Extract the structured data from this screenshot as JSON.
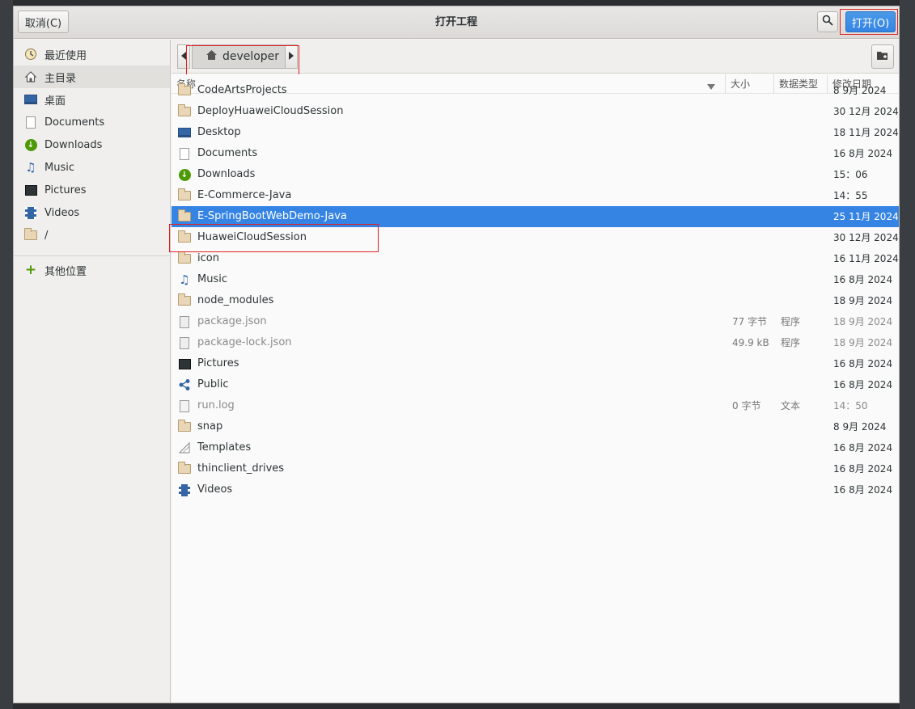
{
  "dialog": {
    "title": "打开工程",
    "cancel_label": "取消(C)",
    "open_label": "打开(O)"
  },
  "sidebar": {
    "items": [
      {
        "label": "最近使用",
        "icon": "recent-icon"
      },
      {
        "label": "主目录",
        "icon": "home-icon"
      },
      {
        "label": "桌面",
        "icon": "desktop-icon"
      },
      {
        "label": "Documents",
        "icon": "document-icon"
      },
      {
        "label": "Downloads",
        "icon": "download-icon"
      },
      {
        "label": "Music",
        "icon": "music-icon"
      },
      {
        "label": "Pictures",
        "icon": "pictures-icon"
      },
      {
        "label": "Videos",
        "icon": "videos-icon"
      },
      {
        "label": "/",
        "icon": "folder-icon"
      }
    ],
    "other_locations": "其他位置"
  },
  "pathbar": {
    "current": "developer"
  },
  "columns": {
    "name": "名称",
    "size": "大小",
    "type": "数据类型",
    "modified": "修改日期"
  },
  "files": [
    {
      "name": "CodeArtsProjects",
      "size": "",
      "type": "",
      "modified": "8 9月 2024",
      "icon": "folder"
    },
    {
      "name": "DeployHuaweiCloudSession",
      "size": "",
      "type": "",
      "modified": "30 12月 2024",
      "icon": "folder"
    },
    {
      "name": "Desktop",
      "size": "",
      "type": "",
      "modified": "18 11月 2024",
      "icon": "desktop"
    },
    {
      "name": "Documents",
      "size": "",
      "type": "",
      "modified": "16 8月 2024",
      "icon": "document"
    },
    {
      "name": "Downloads",
      "size": "",
      "type": "",
      "modified": "15：06",
      "icon": "download"
    },
    {
      "name": "E-Commerce-Java",
      "size": "",
      "type": "",
      "modified": "14：55",
      "icon": "folder"
    },
    {
      "name": "E-SpringBootWebDemo-Java",
      "size": "",
      "type": "",
      "modified": "25 11月 2024",
      "icon": "folder"
    },
    {
      "name": "HuaweiCloudSession",
      "size": "",
      "type": "",
      "modified": "30 12月 2024",
      "icon": "folder"
    },
    {
      "name": "icon",
      "size": "",
      "type": "",
      "modified": "16 11月 2024",
      "icon": "folder"
    },
    {
      "name": "Music",
      "size": "",
      "type": "",
      "modified": "16 8月 2024",
      "icon": "music"
    },
    {
      "name": "node_modules",
      "size": "",
      "type": "",
      "modified": "18 9月 2024",
      "icon": "folder"
    },
    {
      "name": "package.json",
      "size": "77 字节",
      "type": "程序",
      "modified": "18 9月 2024",
      "icon": "gear-doc"
    },
    {
      "name": "package-lock.json",
      "size": "49.9 kB",
      "type": "程序",
      "modified": "18 9月 2024",
      "icon": "gear-doc"
    },
    {
      "name": "Pictures",
      "size": "",
      "type": "",
      "modified": "16 8月 2024",
      "icon": "pictures"
    },
    {
      "name": "Public",
      "size": "",
      "type": "",
      "modified": "16 8月 2024",
      "icon": "share"
    },
    {
      "name": "run.log",
      "size": "0 字节",
      "type": "文本",
      "modified": "14：50",
      "icon": "text-doc"
    },
    {
      "name": "snap",
      "size": "",
      "type": "",
      "modified": "8 9月 2024",
      "icon": "folder"
    },
    {
      "name": "Templates",
      "size": "",
      "type": "",
      "modified": "16 8月 2024",
      "icon": "template"
    },
    {
      "name": "thinclient_drives",
      "size": "",
      "type": "",
      "modified": "16 8月 2024",
      "icon": "folder"
    },
    {
      "name": "Videos",
      "size": "",
      "type": "",
      "modified": "16 8月 2024",
      "icon": "videos"
    }
  ],
  "selected_index": 6,
  "colors": {
    "accent": "#3584e4",
    "highlight_box": "#e02020"
  }
}
